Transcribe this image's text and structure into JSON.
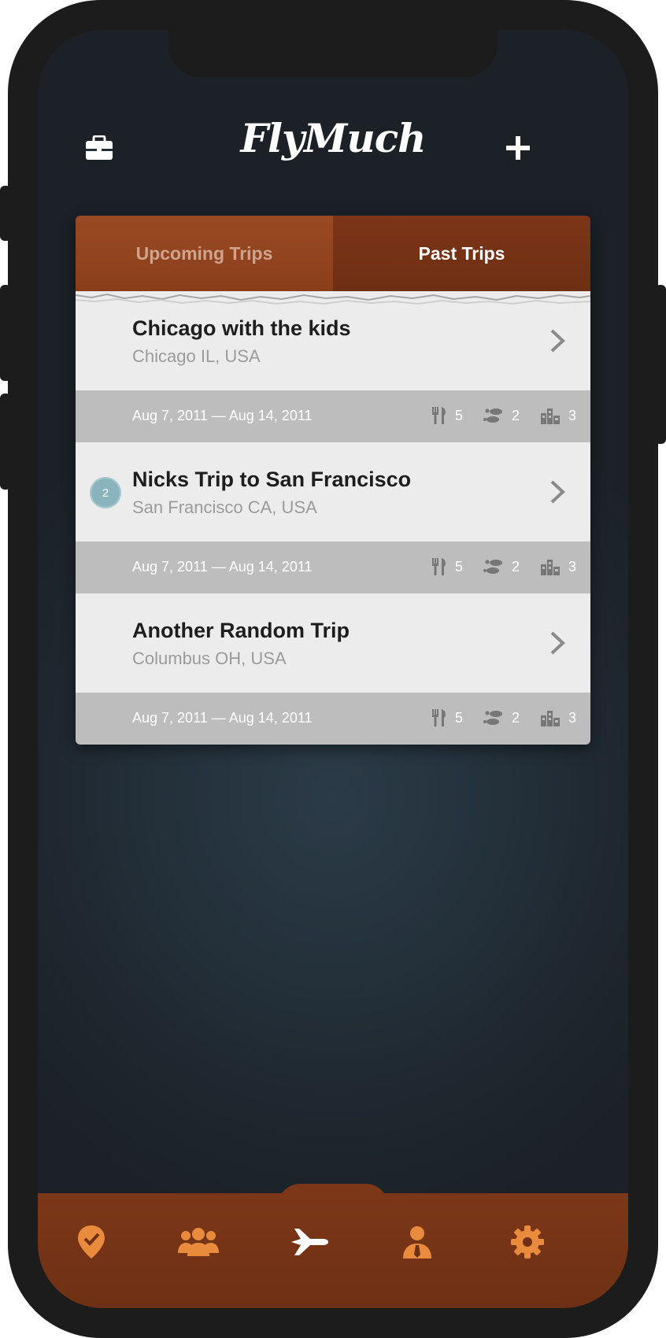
{
  "app": {
    "logo_text": "FlyMuch"
  },
  "header": {
    "left_icon": "briefcase-icon",
    "right_icon": "plus-icon"
  },
  "tabs": {
    "upcoming_label": "Upcoming Trips",
    "past_label": "Past Trips",
    "active": "Past Trips"
  },
  "trips": [
    {
      "title": "Chicago with the kids",
      "location": "Chicago IL, USA",
      "dates": "Aug 7, 2011 — Aug 14, 2011",
      "badge": "",
      "restaurants": "5",
      "activities": "2",
      "sights": "3"
    },
    {
      "title": "Nicks Trip to San Francisco",
      "location": "San Francisco CA, USA",
      "dates": "Aug 7, 2011 — Aug 14, 2011",
      "badge": "2",
      "restaurants": "5",
      "activities": "2",
      "sights": "3"
    },
    {
      "title": "Another Random Trip",
      "location": "Columbus OH, USA",
      "dates": "Aug 7, 2011 — Aug 14, 2011",
      "badge": "",
      "restaurants": "5",
      "activities": "2",
      "sights": "3"
    }
  ],
  "tabbar": {
    "items": [
      "map-pin-check-icon",
      "people-icon",
      "airplane-icon",
      "person-tie-icon",
      "gear-icon"
    ],
    "active": "airplane-icon"
  },
  "colors": {
    "accent_orange": "#e98b3c",
    "tab_bar_brown": "#7c3718",
    "active_tab_icon": "#ffffff"
  }
}
